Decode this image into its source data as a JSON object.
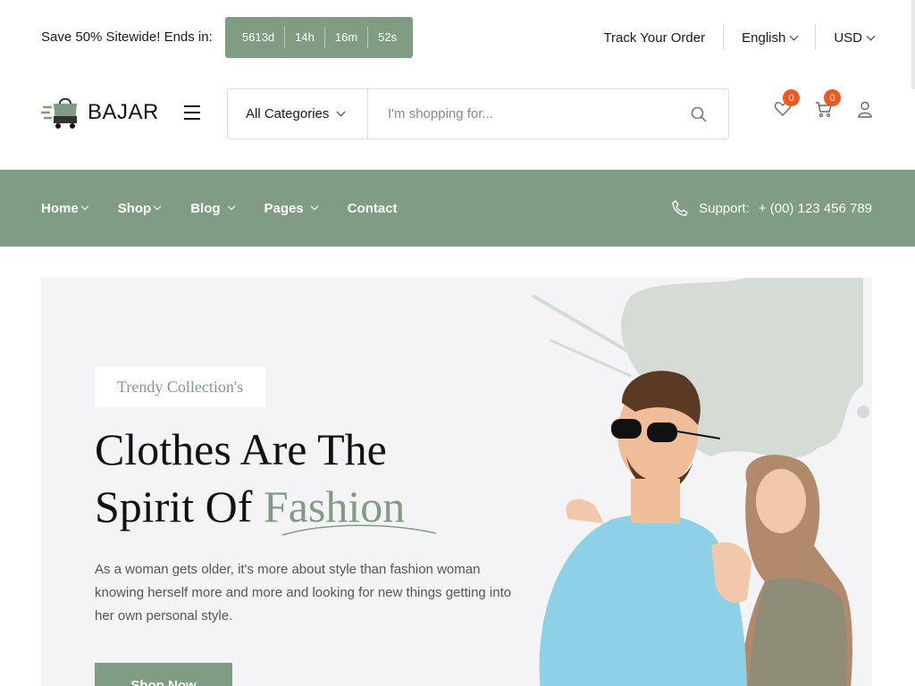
{
  "topbar": {
    "promo": "Save 50% Sitewide! Ends in:",
    "countdown": [
      "5613d",
      "14h",
      "16m",
      "52s"
    ],
    "track_order": "Track Your Order",
    "language": "English",
    "currency": "USD"
  },
  "header": {
    "logo_text": "BAJAR",
    "category_select": "All Categories",
    "search_placeholder": "I'm shopping for...",
    "wishlist_count": "0",
    "cart_count": "0"
  },
  "nav": {
    "items": [
      "Home",
      "Shop",
      "Blog",
      "Pages",
      "Contact"
    ],
    "support_label": "Support:",
    "support_phone": "+ (00) 123 456 789"
  },
  "hero": {
    "tag": "Trendy Collection's",
    "headline_line1": "Clothes Are The",
    "headline_line2_prefix": "Spirit Of",
    "headline_accent": "Fashion",
    "description": "As a woman gets older, it's more about style than fashion woman knowing herself more and more and looking for new things getting into her own personal style.",
    "button": "Shop Now"
  },
  "colors": {
    "accent": "#809c83",
    "badge": "#f2571d",
    "hero_bg": "#f4f4f6"
  },
  "icons": [
    "menu-icon",
    "chevron-down-icon",
    "search-icon",
    "heart-icon",
    "cart-icon",
    "user-icon",
    "phone-icon"
  ]
}
